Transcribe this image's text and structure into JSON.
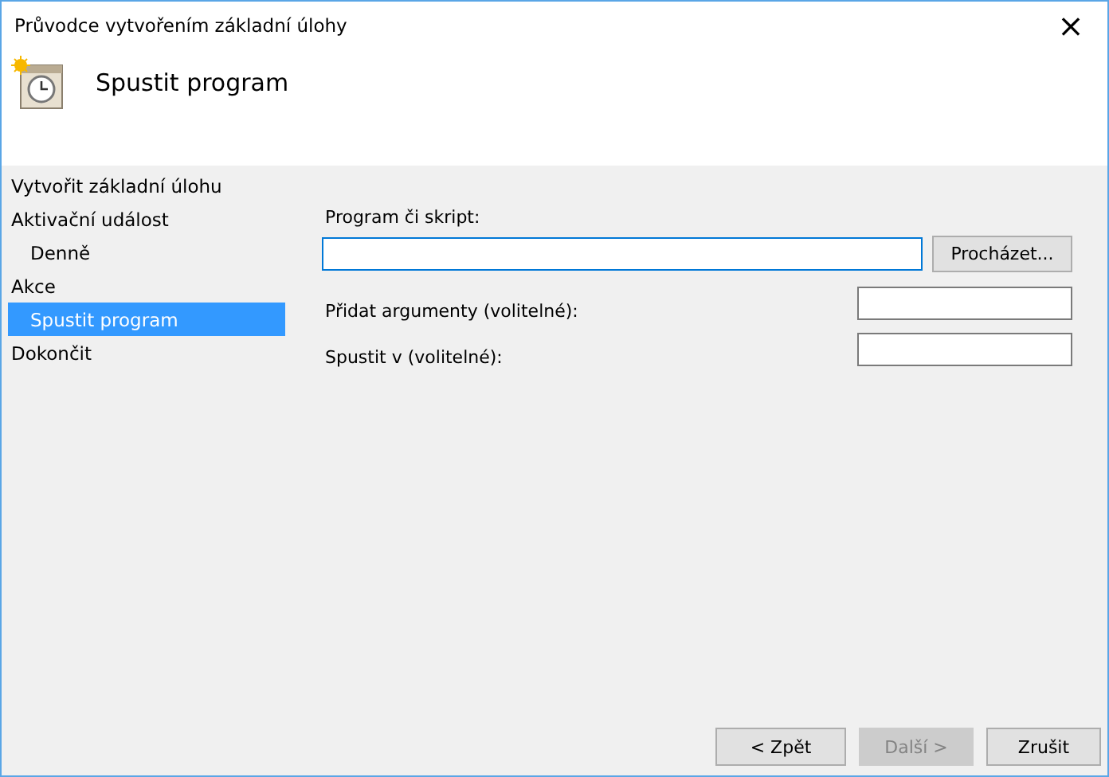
{
  "window": {
    "title": "Průvodce vytvořením základní úlohy",
    "close": "×"
  },
  "header": {
    "title": "Spustit program"
  },
  "sidebar": {
    "items": [
      {
        "label": "Vytvořit základní úlohu",
        "selected": false
      },
      {
        "label": "Aktivační událost",
        "selected": false,
        "children": [
          {
            "label": "Denně",
            "selected": false
          }
        ]
      },
      {
        "label": "Akce",
        "selected": false,
        "children": [
          {
            "label": "Spustit program",
            "selected": true
          }
        ]
      },
      {
        "label": "Dokončit",
        "selected": false
      }
    ]
  },
  "form": {
    "program_label": "Program či skript:",
    "browse_button": "Procházet...",
    "fields": [
      {
        "label": "Přidat argumenty (volitelné):"
      },
      {
        "label": "Spustit v (volitelné):"
      }
    ]
  },
  "buttons": [
    {
      "label": "< Zpět",
      "disabled": false
    },
    {
      "label": "Další >",
      "disabled": true
    },
    {
      "label": "Zrušit",
      "disabled": false
    }
  ]
}
